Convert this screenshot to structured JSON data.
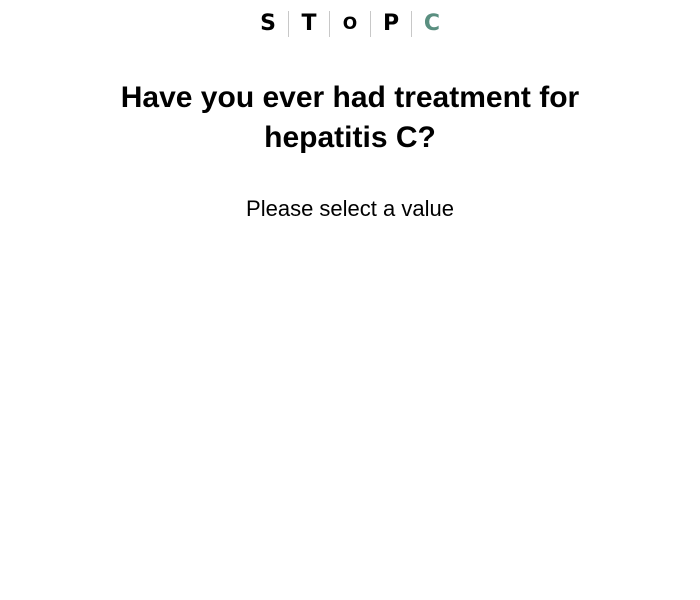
{
  "logo": {
    "letters": [
      "S",
      "T",
      "O",
      "P",
      "C"
    ],
    "accent_color": "#5a8f80",
    "text_color": "#000000"
  },
  "question": {
    "text": "Have you ever had treatment for hepatitis C?"
  },
  "prompt": {
    "text": "Please select a value"
  }
}
